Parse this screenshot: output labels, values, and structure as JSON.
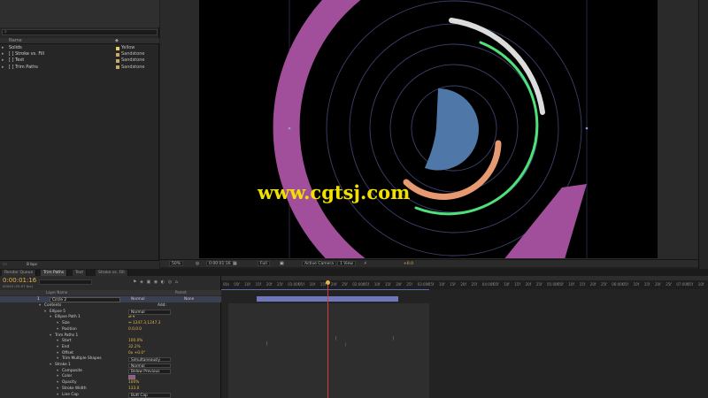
{
  "project": {
    "search_placeholder": "",
    "column_name": "Name",
    "items": [
      {
        "name": "Solids",
        "label_color": "#e5d35a",
        "label": "Yellow"
      },
      {
        "name": "[ ] Stroke vs. Fill",
        "label_color": "#c9a96a",
        "label": "Sandstone"
      },
      {
        "name": "[ ] Text",
        "label_color": "#c9a96a",
        "label": "Sandstone"
      },
      {
        "name": "[ ] Trim Paths",
        "label_color": "#c9a96a",
        "label": "Sandstone"
      }
    ],
    "bpc": "8 bpc"
  },
  "viewer": {
    "zoom": "50%",
    "timecode": "0:00:01:16",
    "resolution": "Full",
    "camera": "Active Camera",
    "views": "1 View",
    "exposure": "+0.0",
    "watermark": "www.cgtsj.com"
  },
  "tabs": [
    "Render Queue",
    "Trim Paths",
    "Text",
    "Stroke vs. Fill"
  ],
  "timeline": {
    "current_time": "0:00:01:16",
    "fps_info": "00040 (29.97 fps)",
    "col_layer_name": "Layer Name",
    "col_parent": "Parent",
    "ruler": [
      "00s",
      "05f",
      "10f",
      "15f",
      "20f",
      "25f",
      "01:00f",
      "05f",
      "10f",
      "15f",
      "20f",
      "25f",
      "02:00f",
      "05f",
      "10f",
      "15f",
      "20f",
      "25f",
      "03:00f",
      "05f",
      "10f",
      "15f",
      "20f",
      "25f",
      "04:00f",
      "05f",
      "10f",
      "15f",
      "20f",
      "25f",
      "05:00f",
      "05f",
      "10f",
      "15f",
      "20f",
      "25f",
      "06:00f",
      "05f",
      "10f",
      "15f",
      "20f",
      "25f",
      "07:00f",
      "05f",
      "10f"
    ],
    "layer": {
      "num": "1",
      "name": "Circle 2",
      "mode": "Normal",
      "parent": "None"
    },
    "rows": [
      {
        "indent": 14,
        "name": "Contents",
        "extra": "Add:"
      },
      {
        "indent": 20,
        "name": "Ellipse 5",
        "menu": "Normal"
      },
      {
        "indent": 26,
        "name": "Ellipse Path 1",
        "value": "⇄ ▾"
      },
      {
        "indent": 34,
        "name": "Size",
        "value": "⇔ 1247.3,1247.3"
      },
      {
        "indent": 34,
        "name": "Position",
        "value": "0.0,0.0"
      },
      {
        "indent": 26,
        "name": "Trim Paths 1",
        "value": ""
      },
      {
        "indent": 34,
        "name": "Start",
        "value": "100.0%"
      },
      {
        "indent": 34,
        "name": "End",
        "value": "32.2%"
      },
      {
        "indent": 34,
        "name": "Offset",
        "value": "0x +0.0°"
      },
      {
        "indent": 34,
        "name": "Trim Multiple Shapes",
        "menu": "Simultaneously"
      },
      {
        "indent": 26,
        "name": "Stroke 1",
        "menu": "Normal"
      },
      {
        "indent": 34,
        "name": "Composite",
        "menu": "Below Previous"
      },
      {
        "indent": 34,
        "name": "Color",
        "value": ""
      },
      {
        "indent": 34,
        "name": "Opacity",
        "value": "100%"
      },
      {
        "indent": 34,
        "name": "Stroke Width",
        "value": "133.0"
      },
      {
        "indent": 34,
        "name": "Line Cap",
        "menu": "Butt Cap"
      }
    ]
  },
  "colors": {
    "accent": "#e4b44a",
    "magenta": "#a24f9b",
    "green": "#4fe07a",
    "white_arc": "#dcdcdc",
    "orange": "#e79a72",
    "blue": "#4f78a8",
    "playhead": "#d23b3b"
  }
}
